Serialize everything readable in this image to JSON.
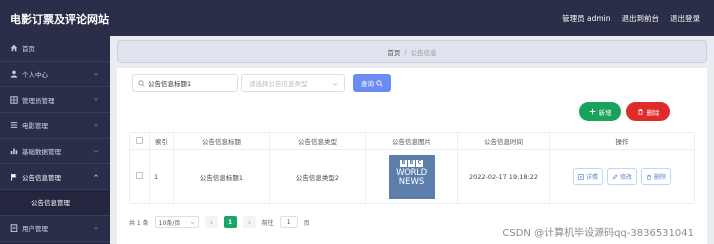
{
  "app": {
    "title": "电影订票及评论网站"
  },
  "header": {
    "user_label": "管理员 admin",
    "back_label": "退出到前台",
    "logout_label": "退出登录"
  },
  "sidebar": {
    "items": [
      {
        "label": "首页",
        "icon": "home-icon"
      },
      {
        "label": "个人中心",
        "icon": "user-icon"
      },
      {
        "label": "管理员管理",
        "icon": "grid-icon"
      },
      {
        "label": "电影管理",
        "icon": "list-icon"
      },
      {
        "label": "基础数据管理",
        "icon": "bar-chart-icon"
      },
      {
        "label": "公告信息管理",
        "icon": "flag-icon"
      },
      {
        "label": "公告信息管理",
        "icon": ""
      },
      {
        "label": "用户管理",
        "icon": "document-icon"
      }
    ]
  },
  "breadcrumb": {
    "home": "首页",
    "separator": "/",
    "current": "公告信息"
  },
  "search": {
    "value": "公告信息标题1",
    "type_placeholder": "请选择公告信息类型",
    "query_label": "查询"
  },
  "actions": {
    "add_label": "新增",
    "delete_label": "删除"
  },
  "table": {
    "headers": [
      "索引",
      "公告信息标题",
      "公告信息类型",
      "公告信息图片",
      "公告信息时间",
      "操作"
    ],
    "rows": [
      {
        "index": "1",
        "title": "公告信息标题1",
        "type": "公告信息类型2",
        "image_logo": "BBC",
        "image_line1": "WORLD",
        "image_line2": "NEWS",
        "time": "2022-02-17 19:18:22",
        "op_detail": "详情",
        "op_edit": "修改",
        "op_delete": "删除"
      }
    ]
  },
  "pagination": {
    "total": "共 1 条",
    "page_size": "10条/页",
    "current_page": "1",
    "goto_label": "前往",
    "goto_value": "1",
    "page_suffix": "页"
  },
  "watermark": "CSDN @计算机毕设源码qq-3836531041",
  "colors": {
    "topbar": "#2b2e48",
    "query": "#6c8cf5",
    "add": "#19a35a",
    "delete": "#e02b2b",
    "page_active": "#1aa566"
  }
}
